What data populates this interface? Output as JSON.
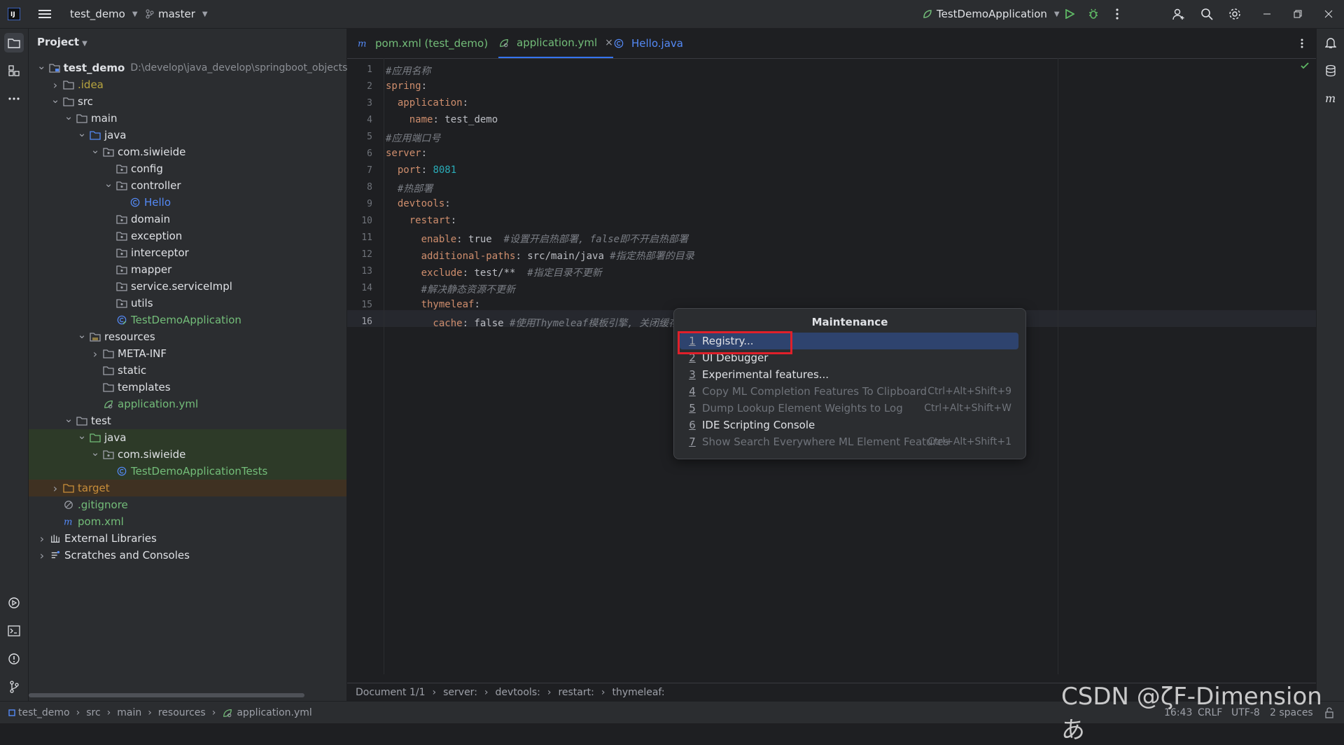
{
  "titlebar": {
    "project": "test_demo",
    "branch": "master",
    "run_config": "TestDemoApplication"
  },
  "project_panel": {
    "title": "Project",
    "tree": [
      {
        "label": "test_demo",
        "hint": "D:\\develop\\java_develop\\springboot_objects\\te",
        "depth": 0,
        "arrow": "open",
        "icon": "module",
        "bold": true,
        "color": "#dfe1e5"
      },
      {
        "label": ".idea",
        "depth": 1,
        "arrow": "closed",
        "icon": "folder",
        "color": "#b8a53f"
      },
      {
        "label": "src",
        "depth": 1,
        "arrow": "open",
        "icon": "folder",
        "color": "#dfe1e5"
      },
      {
        "label": "main",
        "depth": 2,
        "arrow": "open",
        "icon": "folder",
        "color": "#dfe1e5"
      },
      {
        "label": "java",
        "depth": 3,
        "arrow": "open",
        "icon": "src-folder",
        "color": "#dfe1e5"
      },
      {
        "label": "com.siwieide",
        "depth": 4,
        "arrow": "open",
        "icon": "package",
        "color": "#dfe1e5"
      },
      {
        "label": "config",
        "depth": 5,
        "arrow": "none",
        "icon": "package",
        "color": "#dfe1e5"
      },
      {
        "label": "controller",
        "depth": 5,
        "arrow": "open",
        "icon": "package",
        "color": "#dfe1e5"
      },
      {
        "label": "Hello",
        "depth": 6,
        "arrow": "none",
        "icon": "class",
        "color": "#548af7"
      },
      {
        "label": "domain",
        "depth": 5,
        "arrow": "none",
        "icon": "package",
        "color": "#dfe1e5"
      },
      {
        "label": "exception",
        "depth": 5,
        "arrow": "none",
        "icon": "package",
        "color": "#dfe1e5"
      },
      {
        "label": "interceptor",
        "depth": 5,
        "arrow": "none",
        "icon": "package",
        "color": "#dfe1e5"
      },
      {
        "label": "mapper",
        "depth": 5,
        "arrow": "none",
        "icon": "package",
        "color": "#dfe1e5"
      },
      {
        "label": "service.serviceImpl",
        "depth": 5,
        "arrow": "none",
        "icon": "package",
        "color": "#dfe1e5"
      },
      {
        "label": "utils",
        "depth": 5,
        "arrow": "none",
        "icon": "package",
        "color": "#dfe1e5"
      },
      {
        "label": "TestDemoApplication",
        "depth": 5,
        "arrow": "none",
        "icon": "spring-class",
        "color": "#73bd79"
      },
      {
        "label": "resources",
        "depth": 3,
        "arrow": "open",
        "icon": "res-folder",
        "color": "#dfe1e5"
      },
      {
        "label": "META-INF",
        "depth": 4,
        "arrow": "closed",
        "icon": "folder",
        "color": "#dfe1e5"
      },
      {
        "label": "static",
        "depth": 4,
        "arrow": "none",
        "icon": "folder",
        "color": "#dfe1e5"
      },
      {
        "label": "templates",
        "depth": 4,
        "arrow": "none",
        "icon": "folder",
        "color": "#dfe1e5"
      },
      {
        "label": "application.yml",
        "depth": 4,
        "arrow": "none",
        "icon": "yml",
        "color": "#73bd79"
      },
      {
        "label": "test",
        "depth": 2,
        "arrow": "open",
        "icon": "folder",
        "color": "#dfe1e5"
      },
      {
        "label": "java",
        "depth": 3,
        "arrow": "open",
        "icon": "test-folder",
        "color": "#dfe1e5",
        "highlight": "green"
      },
      {
        "label": "com.siwieide",
        "depth": 4,
        "arrow": "open",
        "icon": "package",
        "color": "#dfe1e5",
        "highlight": "green"
      },
      {
        "label": "TestDemoApplicationTests",
        "depth": 5,
        "arrow": "none",
        "icon": "class",
        "color": "#73bd79",
        "highlight": "green"
      },
      {
        "label": "target",
        "depth": 1,
        "arrow": "closed",
        "icon": "excluded-folder",
        "color": "#c98e3a",
        "highlight": "orange"
      },
      {
        "label": ".gitignore",
        "depth": 1,
        "arrow": "none",
        "icon": "ignore",
        "color": "#73bd79"
      },
      {
        "label": "pom.xml",
        "depth": 1,
        "arrow": "none",
        "icon": "maven",
        "color": "#73bd79"
      },
      {
        "label": "External Libraries",
        "depth": 0,
        "arrow": "closed",
        "icon": "library",
        "color": "#dfe1e5"
      },
      {
        "label": "Scratches and Consoles",
        "depth": 0,
        "arrow": "closed",
        "icon": "scratches",
        "color": "#dfe1e5"
      }
    ]
  },
  "tabs": [
    {
      "label": "pom.xml (test_demo)",
      "icon": "maven",
      "color": "#73bd79",
      "active": false
    },
    {
      "label": "application.yml",
      "icon": "yml",
      "color": "#73bd79",
      "active": true,
      "closable": true
    },
    {
      "label": "Hello.java",
      "icon": "class",
      "color": "#548af7",
      "active": false
    }
  ],
  "code_lines": [
    [
      {
        "t": "#应用名称",
        "c": "c"
      }
    ],
    [
      {
        "t": "spring",
        "c": "k"
      },
      {
        "t": ":",
        "c": "v"
      }
    ],
    [
      {
        "t": "  application",
        "c": "k"
      },
      {
        "t": ":",
        "c": "v"
      }
    ],
    [
      {
        "t": "    name",
        "c": "k"
      },
      {
        "t": ": test_demo",
        "c": "v"
      }
    ],
    [
      {
        "t": "#应用端口号",
        "c": "c"
      }
    ],
    [
      {
        "t": "server",
        "c": "k"
      },
      {
        "t": ":",
        "c": "v"
      }
    ],
    [
      {
        "t": "  port",
        "c": "k"
      },
      {
        "t": ": ",
        "c": "v"
      },
      {
        "t": "8081",
        "c": "n"
      }
    ],
    [
      {
        "t": "  #热部署",
        "c": "c"
      }
    ],
    [
      {
        "t": "  devtools",
        "c": "k"
      },
      {
        "t": ":",
        "c": "v"
      }
    ],
    [
      {
        "t": "    restart",
        "c": "k"
      },
      {
        "t": ":",
        "c": "v"
      }
    ],
    [
      {
        "t": "      enable",
        "c": "k"
      },
      {
        "t": ": true  ",
        "c": "v"
      },
      {
        "t": "#设置开启热部署, false即不开启热部署",
        "c": "c"
      }
    ],
    [
      {
        "t": "      additional-paths",
        "c": "k"
      },
      {
        "t": ": src/main/java ",
        "c": "v"
      },
      {
        "t": "#指定热部署的目录",
        "c": "c"
      }
    ],
    [
      {
        "t": "      exclude",
        "c": "k"
      },
      {
        "t": ": test/**  ",
        "c": "v"
      },
      {
        "t": "#指定目录不更新",
        "c": "c"
      }
    ],
    [
      {
        "t": "      #解决静态资源不更新",
        "c": "c"
      }
    ],
    [
      {
        "t": "      thymeleaf",
        "c": "k"
      },
      {
        "t": ":",
        "c": "v"
      }
    ],
    [
      {
        "t": "        cache",
        "c": "k"
      },
      {
        "t": ": false ",
        "c": "v"
      },
      {
        "t": "#使用Thymeleaf模板引擎, 关闭缓存",
        "c": "c"
      }
    ]
  ],
  "breadcrumb": [
    "Document 1/1",
    "server:",
    "devtools:",
    "restart:",
    "thymeleaf:"
  ],
  "status": {
    "path": [
      "test_demo",
      "src",
      "main",
      "resources",
      "application.yml"
    ],
    "position": "16:43",
    "line_sep": "CRLF",
    "encoding": "UTF-8",
    "indent": "2 spaces"
  },
  "popup": {
    "title": "Maintenance",
    "items": [
      {
        "num": "1",
        "label": "Registry...",
        "shortcut": "",
        "enabled": true,
        "selected": true
      },
      {
        "num": "2",
        "label": "UI Debugger",
        "shortcut": "",
        "enabled": true
      },
      {
        "num": "3",
        "label": "Experimental features...",
        "shortcut": "",
        "enabled": true
      },
      {
        "num": "4",
        "label": "Copy ML Completion Features To Clipboard",
        "shortcut": "Ctrl+Alt+Shift+9",
        "enabled": false
      },
      {
        "num": "5",
        "label": "Dump Lookup Element Weights to Log",
        "shortcut": "Ctrl+Alt+Shift+W",
        "enabled": false
      },
      {
        "num": "6",
        "label": "IDE Scripting Console",
        "shortcut": "",
        "enabled": true
      },
      {
        "num": "7",
        "label": "Show Search Everywhere ML Element Features",
        "shortcut": "Ctrl+Alt+Shift+1",
        "enabled": false
      }
    ]
  },
  "watermark": "CSDN @ζF-Dimension あ"
}
